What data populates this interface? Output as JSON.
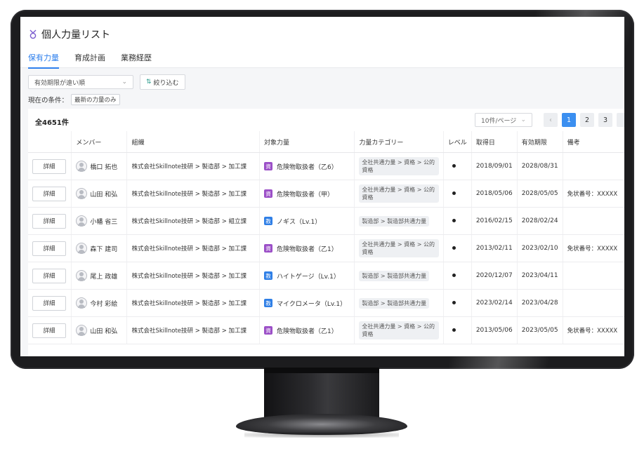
{
  "page": {
    "title": "個人力量リスト",
    "tabs": [
      "保有力量",
      "育成計画",
      "業務経歴"
    ],
    "active_tab": 0
  },
  "toolbar": {
    "sort_value": "有効期限が遠い順",
    "filter_label": "絞り込む",
    "conditions_label": "現在の条件：",
    "condition_tag": "最新の力量のみ"
  },
  "table": {
    "total": "全4651件",
    "per_page": "10件/ページ",
    "pages": [
      "1",
      "2",
      "3"
    ],
    "active_page": "1",
    "headers": {
      "member": "メンバー",
      "org": "組織",
      "skill": "対象力量",
      "category": "力量カテゴリー",
      "level": "レベル",
      "acquired": "取得日",
      "expiry": "有効期限",
      "remark": "備考"
    },
    "detail_label": "詳細",
    "badge_labels": {
      "cert": "資",
      "edu": "教"
    },
    "rows": [
      {
        "member": "橋口 拓也",
        "org": "株式会社Skillnote技研 > 製造部 > 加工課",
        "badge": "cert",
        "skill": "危険物取扱者（乙6）",
        "category": "全社共通力量 > 資格 > 公的資格",
        "acquired": "2018/09/01",
        "expiry": "2028/08/31",
        "remark": ""
      },
      {
        "member": "山田 和弘",
        "org": "株式会社Skillnote技研 > 製造部 > 加工課",
        "badge": "cert",
        "skill": "危険物取扱者（甲）",
        "category": "全社共通力量 > 資格 > 公的資格",
        "acquired": "2018/05/06",
        "expiry": "2028/05/05",
        "remark": "免状番号：XXXXX"
      },
      {
        "member": "小幡 省三",
        "org": "株式会社Skillnote技研 > 製造部 > 組立課",
        "badge": "edu",
        "skill": "ノギス（Lv.1）",
        "category": "製造部 > 製造部共通力量",
        "acquired": "2016/02/15",
        "expiry": "2028/02/24",
        "remark": ""
      },
      {
        "member": "森下 建司",
        "org": "株式会社Skillnote技研 > 製造部 > 加工課",
        "badge": "cert",
        "skill": "危険物取扱者（乙1）",
        "category": "全社共通力量 > 資格 > 公的資格",
        "acquired": "2013/02/11",
        "expiry": "2023/02/10",
        "remark": "免状番号：XXXXX"
      },
      {
        "member": "尾上 政雄",
        "org": "株式会社Skillnote技研 > 製造部 > 加工課",
        "badge": "edu",
        "skill": "ハイトゲージ（Lv.1）",
        "category": "製造部 > 製造部共通力量",
        "acquired": "2020/12/07",
        "expiry": "2023/04/11",
        "remark": ""
      },
      {
        "member": "今村 彩絵",
        "org": "株式会社Skillnote技研 > 製造部 > 加工課",
        "badge": "edu",
        "skill": "マイクロメータ（Lv.1）",
        "category": "製造部 > 製造部共通力量",
        "acquired": "2023/02/14",
        "expiry": "2023/04/28",
        "remark": ""
      },
      {
        "member": "山田 和弘",
        "org": "株式会社Skillnote技研 > 製造部 > 加工課",
        "badge": "cert",
        "skill": "危険物取扱者（乙1）",
        "category": "全社共通力量 > 資格 > 公的資格",
        "acquired": "2013/05/06",
        "expiry": "2023/05/05",
        "remark": "免状番号：XXXXX"
      }
    ]
  },
  "colors": {
    "accent": "#2f80ed",
    "badge_cert": "#9b4fc7",
    "badge_edu": "#2f7fe6",
    "bezel": "#1c1c1e"
  },
  "icons": {
    "title_icon": "medal-icon",
    "filter_icon": "filter-icon",
    "sort_chevron": "chevron-down-icon",
    "avatar": "user-avatar-icon"
  }
}
